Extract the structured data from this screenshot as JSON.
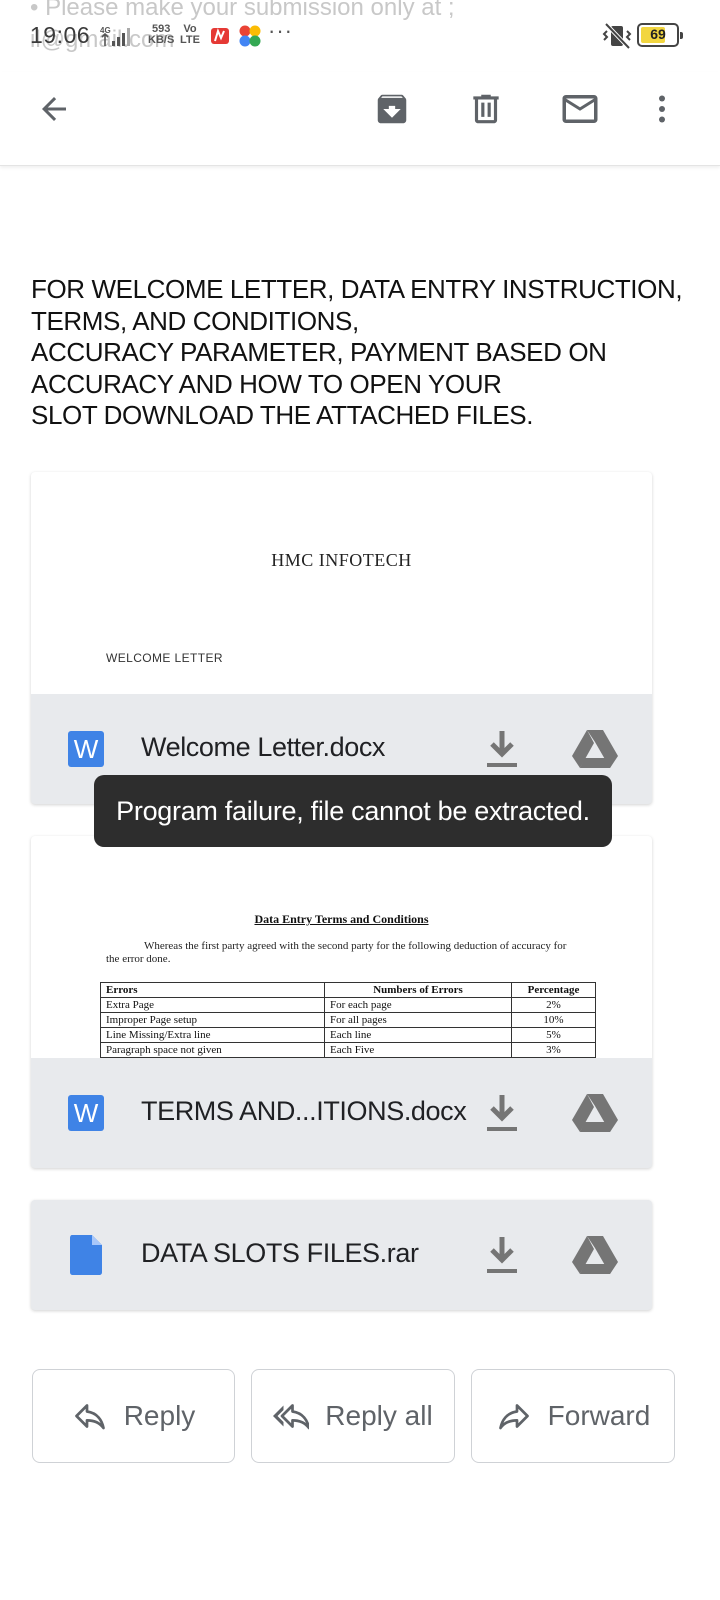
{
  "status_bar": {
    "background_line1": "• Please make your submission only at ;",
    "background_line2": "                            il@gmail.com",
    "time": "19:06",
    "network_type": "4G",
    "speed_value": "593",
    "speed_unit": "KB/S",
    "volte_top": "Vo",
    "volte_bottom": "LTE",
    "more": "···",
    "battery_level": "69"
  },
  "toolbar": {
    "back_icon": "back-arrow-icon",
    "archive_icon": "archive-icon",
    "delete_icon": "delete-icon",
    "mark_unread_icon": "mail-icon",
    "more_icon": "more-vert-icon"
  },
  "email_body": {
    "line1": "FOR WELCOME LETTER, DATA ENTRY INSTRUCTION,",
    "line2": "TERMS, AND CONDITIONS,",
    "line3": "ACCURACY PARAMETER, PAYMENT BASED ON",
    "line4": "ACCURACY AND HOW TO OPEN YOUR",
    "line5": "SLOT DOWNLOAD THE ATTACHED FILES."
  },
  "attachments": [
    {
      "name": "Welcome Letter.docx",
      "type_icon": "W",
      "preview_title": "HMC INFOTECH",
      "preview_subtitle": "WELCOME LETTER"
    },
    {
      "name": "TERMS AND...ITIONS.docx",
      "type_icon": "W",
      "preview_title": "Data Entry Terms and Conditions",
      "preview_paragraph": "Whereas the first party agreed with the second party for the following deduction of accuracy for the error done.",
      "table": {
        "headers": [
          "Errors",
          "Numbers of Errors",
          "Percentage"
        ],
        "rows": [
          [
            "Extra Page",
            "For each page",
            "2%"
          ],
          [
            "Improper Page setup",
            "For all pages",
            "10%"
          ],
          [
            "Line Missing/Extra line",
            "Each line",
            "5%"
          ],
          [
            "Paragraph space not given",
            "Each Five",
            "3%"
          ]
        ]
      }
    },
    {
      "name": "DATA SLOTS FILES.rar",
      "type_icon": "file-icon"
    }
  ],
  "toast": {
    "message": "Program failure, file cannot be extracted."
  },
  "actions": {
    "reply": "Reply",
    "reply_all": "Reply all",
    "forward": "Forward"
  },
  "colors": {
    "word_blue": "#3f83e6",
    "attachment_bg": "#e8eaed",
    "toast_bg": "#2d2d2d",
    "icon_gray": "#5f6368",
    "battery_yellow": "#f2d640"
  }
}
